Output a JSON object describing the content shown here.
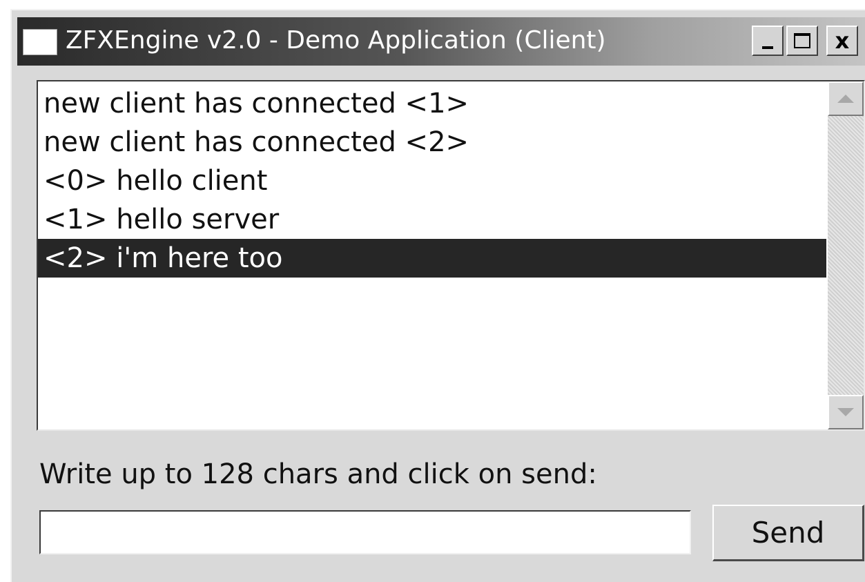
{
  "window": {
    "title": "ZFXEngine v2.0 - Demo Application (Client)",
    "controls": {
      "minimize_label": "_",
      "maximize_label": "□",
      "close_label": "x"
    }
  },
  "messages": {
    "items": [
      {
        "text": "new client has connected <1>",
        "selected": false
      },
      {
        "text": "new client has connected <2>",
        "selected": false
      },
      {
        "text": "<0> hello client",
        "selected": false
      },
      {
        "text": "<1> hello server",
        "selected": false
      },
      {
        "text": "<2> i'm here too",
        "selected": true
      }
    ]
  },
  "compose": {
    "prompt": "Write up to 128 chars and click on send:",
    "input_value": "",
    "send_label": "Send"
  }
}
